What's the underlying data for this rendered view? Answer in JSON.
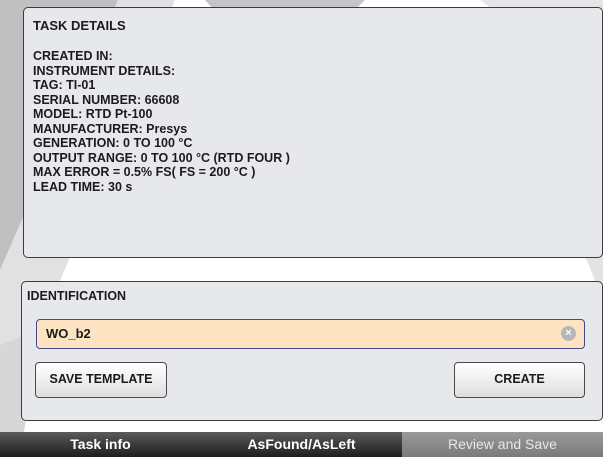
{
  "details": {
    "title": "TASK DETAILS",
    "lines": [
      "CREATED IN:",
      "INSTRUMENT DETAILS:",
      "TAG: TI-01",
      "SERIAL NUMBER: 66608",
      "MODEL: RTD Pt-100",
      "MANUFACTURER: Presys",
      "GENERATION: 0 TO 100 °C",
      "OUTPUT RANGE: 0 TO 100 °C (RTD FOUR )",
      "MAX ERROR = 0.5% FS( FS = 200 °C )",
      "LEAD TIME: 30 s"
    ]
  },
  "identification": {
    "title": "IDENTIFICATION",
    "value": "WO_b2",
    "clear_glyph": "×",
    "save_template_label": "SAVE TEMPLATE",
    "create_label": "CREATE"
  },
  "tabs": [
    {
      "label": "Task info",
      "active": false
    },
    {
      "label": "AsFound/AsLeft",
      "active": false
    },
    {
      "label": "Review and Save",
      "active": true
    }
  ],
  "colors": {
    "panel": "#e7e8ec",
    "field": "#fde3c2",
    "background_shape": "#8c8c8c"
  }
}
